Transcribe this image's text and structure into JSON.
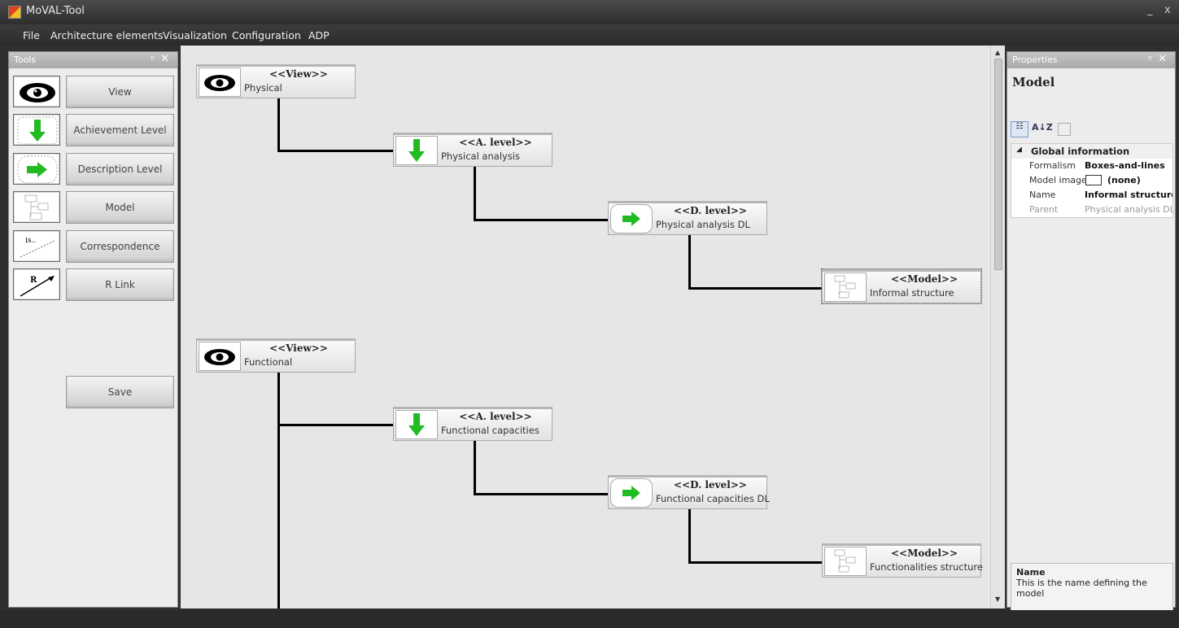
{
  "window": {
    "title": "MoVAL-Tool",
    "minimize": "_",
    "close": "x"
  },
  "menu": [
    "File",
    "Architecture elements",
    "Visualization",
    "Configuration",
    "ADP"
  ],
  "tools_panel": {
    "title": "Tools",
    "pin": "ᵖ",
    "close": "✕",
    "buttons": [
      "View",
      "Achievement Level",
      "Description Level",
      "Model",
      "Correspondence",
      "R Link"
    ],
    "icons": [
      "eye-icon",
      "arrow-down-icon",
      "arrow-right-icon",
      "model-icon",
      "correspondence-icon",
      "r-link-icon"
    ],
    "correspondence_glyph": "is..",
    "rlink_glyph": "R",
    "save": "Save"
  },
  "diagram": {
    "groups": [
      {
        "view": {
          "stereotype": "<<View>>",
          "name": "Physical"
        },
        "a_level": {
          "stereotype": "<<A. level>>",
          "name": "Physical analysis"
        },
        "d_level": {
          "stereotype": "<<D. level>>",
          "name": "Physical analysis DL"
        },
        "model": {
          "stereotype": "<<Model>>",
          "name": "Informal structure"
        }
      },
      {
        "view": {
          "stereotype": "<<View>>",
          "name": "Functional"
        },
        "a_level": {
          "stereotype": "<<A. level>>",
          "name": "Functional capacities"
        },
        "d_level": {
          "stereotype": "<<D. level>>",
          "name": "Functional capacities DL"
        },
        "model": {
          "stereotype": "<<Model>>",
          "name": "Functionalities structure"
        }
      }
    ]
  },
  "properties": {
    "title": "Properties",
    "object": "Model",
    "toolbar_sort": "A↓Z",
    "category": "Global information",
    "rows": [
      {
        "key": "Formalism",
        "value": "Boxes-and-lines"
      },
      {
        "key": "Model image",
        "value": "(none)"
      },
      {
        "key": "Name",
        "value": "Informal structure"
      },
      {
        "key": "Parent",
        "value": "Physical analysis DL"
      }
    ],
    "help_title": "Name",
    "help_text": "This is the name defining the model"
  },
  "colors": {
    "accent_green": "#22bb22",
    "chrome_dark": "#2f2f2f"
  }
}
